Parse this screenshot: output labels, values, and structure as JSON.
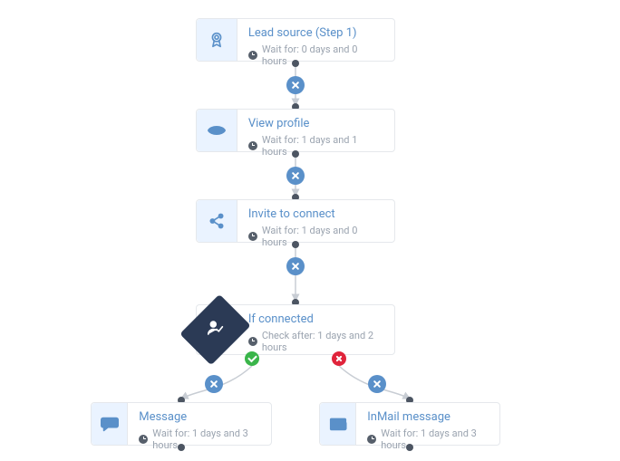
{
  "meta_prefix_wait": "Wait for:",
  "meta_prefix_check": "Check after:",
  "nodes": {
    "lead": {
      "title": "Lead source (Step 1)",
      "meta": "0 days and 0 hours"
    },
    "view": {
      "title": "View profile",
      "meta": "1 days and 1 hours"
    },
    "invite": {
      "title": "Invite to connect",
      "meta": "1 days and 0 hours"
    },
    "cond": {
      "title": "If connected",
      "meta": "1 days and 2 hours"
    },
    "msg": {
      "title": "Message",
      "meta": "1 days and 3 hours"
    },
    "inmail": {
      "title": "InMail message",
      "meta": "1 days and 3 hours"
    }
  }
}
